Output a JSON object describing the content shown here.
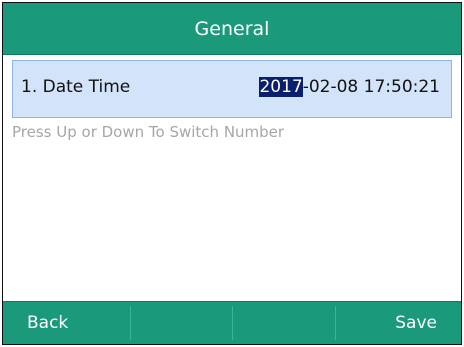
{
  "header": {
    "title": "General"
  },
  "setting": {
    "label": "1. Date Time",
    "value_selected": "2017",
    "value_rest": "-02-08 17:50:21"
  },
  "hint": "Press Up or Down To Switch Number",
  "softkeys": [
    "Back",
    "",
    "",
    "Save"
  ],
  "colors": {
    "bar": "#1a9a7a",
    "row_highlight": "#d3e4fa",
    "selection": "#0a1f6e",
    "hint_text": "#a6a6a6"
  }
}
